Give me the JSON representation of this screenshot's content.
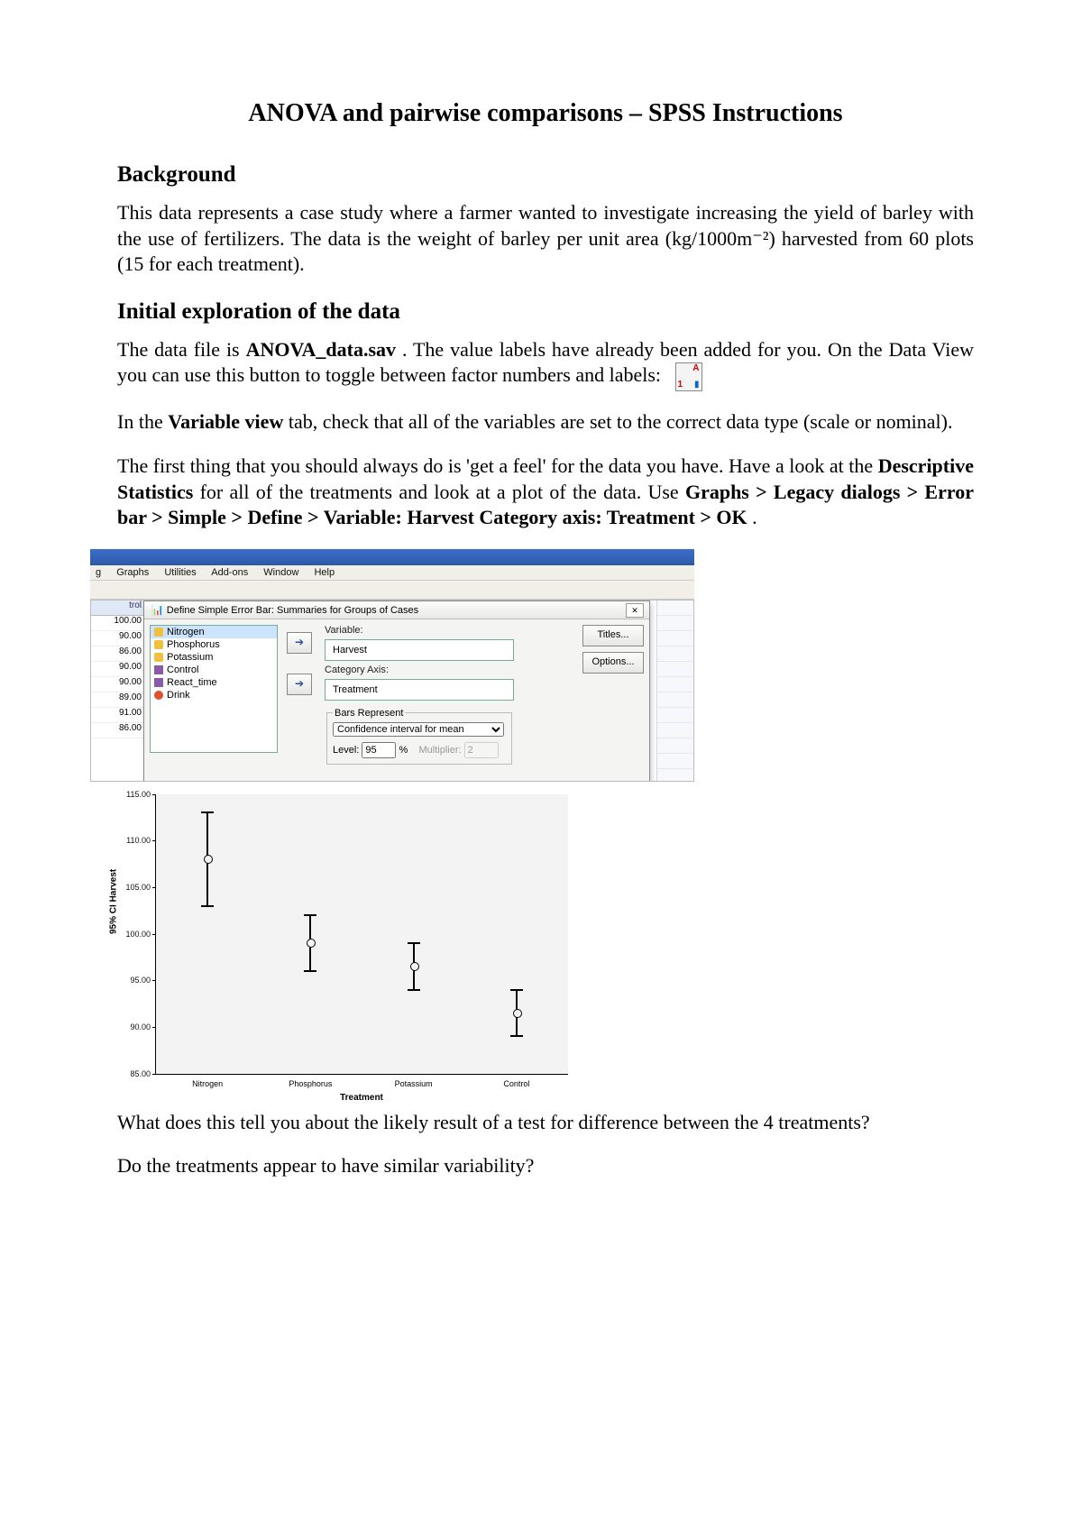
{
  "title": "ANOVA and pairwise comparisons – SPSS Instructions",
  "sections": {
    "background": "Background",
    "explore": "Initial exploration of the data"
  },
  "body": {
    "p1": "This data represents a case study where a farmer wanted to investigate increasing the yield of barley with the use of fertilizers. The data is the weight of barley per unit area (kg/1000m⁻²) harvested from 60 plots (15 for each treatment).",
    "p2a": "The data file is ",
    "p2_file": "ANOVA_data.sav",
    "p2b": ". The value labels have already been added for you. On the Data View you can use this button to toggle between factor numbers and labels:",
    "p3a": "In the ",
    "p3_bold": "Variable view",
    "p3b": " tab, check that all of the variables are set to the correct data type (scale or nominal).",
    "p4a": "The first thing that you should always do is 'get a feel' for the data you have. Have a look at the ",
    "p4_b1": "Descriptive Statistics",
    "p4b": " for all of the treatments and look at a plot of the data. Use ",
    "p4_b2": "Graphs > Legacy dialogs > Error bar > Simple > Define > Variable: Harvest Category axis: Treatment > OK",
    "p4c": ".",
    "p5": "What does this tell you about the likely result of a test for difference between the 4 treatments?",
    "p6": "Do the treatments appear to have similar variability?"
  },
  "spss": {
    "menu": [
      "g",
      "Graphs",
      "Utilities",
      "Add-ons",
      "Window",
      "Help"
    ],
    "dialog_title": "Define Simple Error Bar: Summaries for Groups of Cases",
    "left_header": "trol",
    "left_values": [
      "100.00",
      "90.00",
      "86.00",
      "90.00",
      "90.00",
      "89.00",
      "91.00",
      "86.00"
    ],
    "vars": [
      "Nitrogen",
      "Phosphorus",
      "Potassium",
      "Control",
      "React_time",
      "Drink"
    ],
    "label_variable": "Variable:",
    "var_selected": "Harvest",
    "label_cat": "Category Axis:",
    "cat_selected": "Treatment",
    "legend_bars": "Bars Represent",
    "bars_option": "Confidence interval for mean",
    "level_label": "Level:",
    "level_val": "95",
    "pct": "%",
    "mult_label": "Multiplier:",
    "mult_val": "2",
    "btn_titles": "Titles...",
    "btn_options": "Options..."
  },
  "chart_data": {
    "type": "errorbar",
    "title": "",
    "xlabel": "Treatment",
    "ylabel": "95% CI Harvest",
    "ylim": [
      85,
      115
    ],
    "yticks": [
      85,
      90,
      95,
      100,
      105,
      110,
      115
    ],
    "ytick_labels": [
      "85.00",
      "90.00",
      "95.00",
      "100.00",
      "105.00",
      "110.00",
      "115.00"
    ],
    "categories": [
      "Nitrogen",
      "Phosphorus",
      "Potassium",
      "Control"
    ],
    "series": [
      {
        "name": "95% CI Harvest",
        "mean": [
          108,
          99,
          96.5,
          91.5
        ],
        "low": [
          103,
          96,
          94,
          89
        ],
        "high": [
          113,
          102,
          99,
          94
        ]
      }
    ]
  }
}
